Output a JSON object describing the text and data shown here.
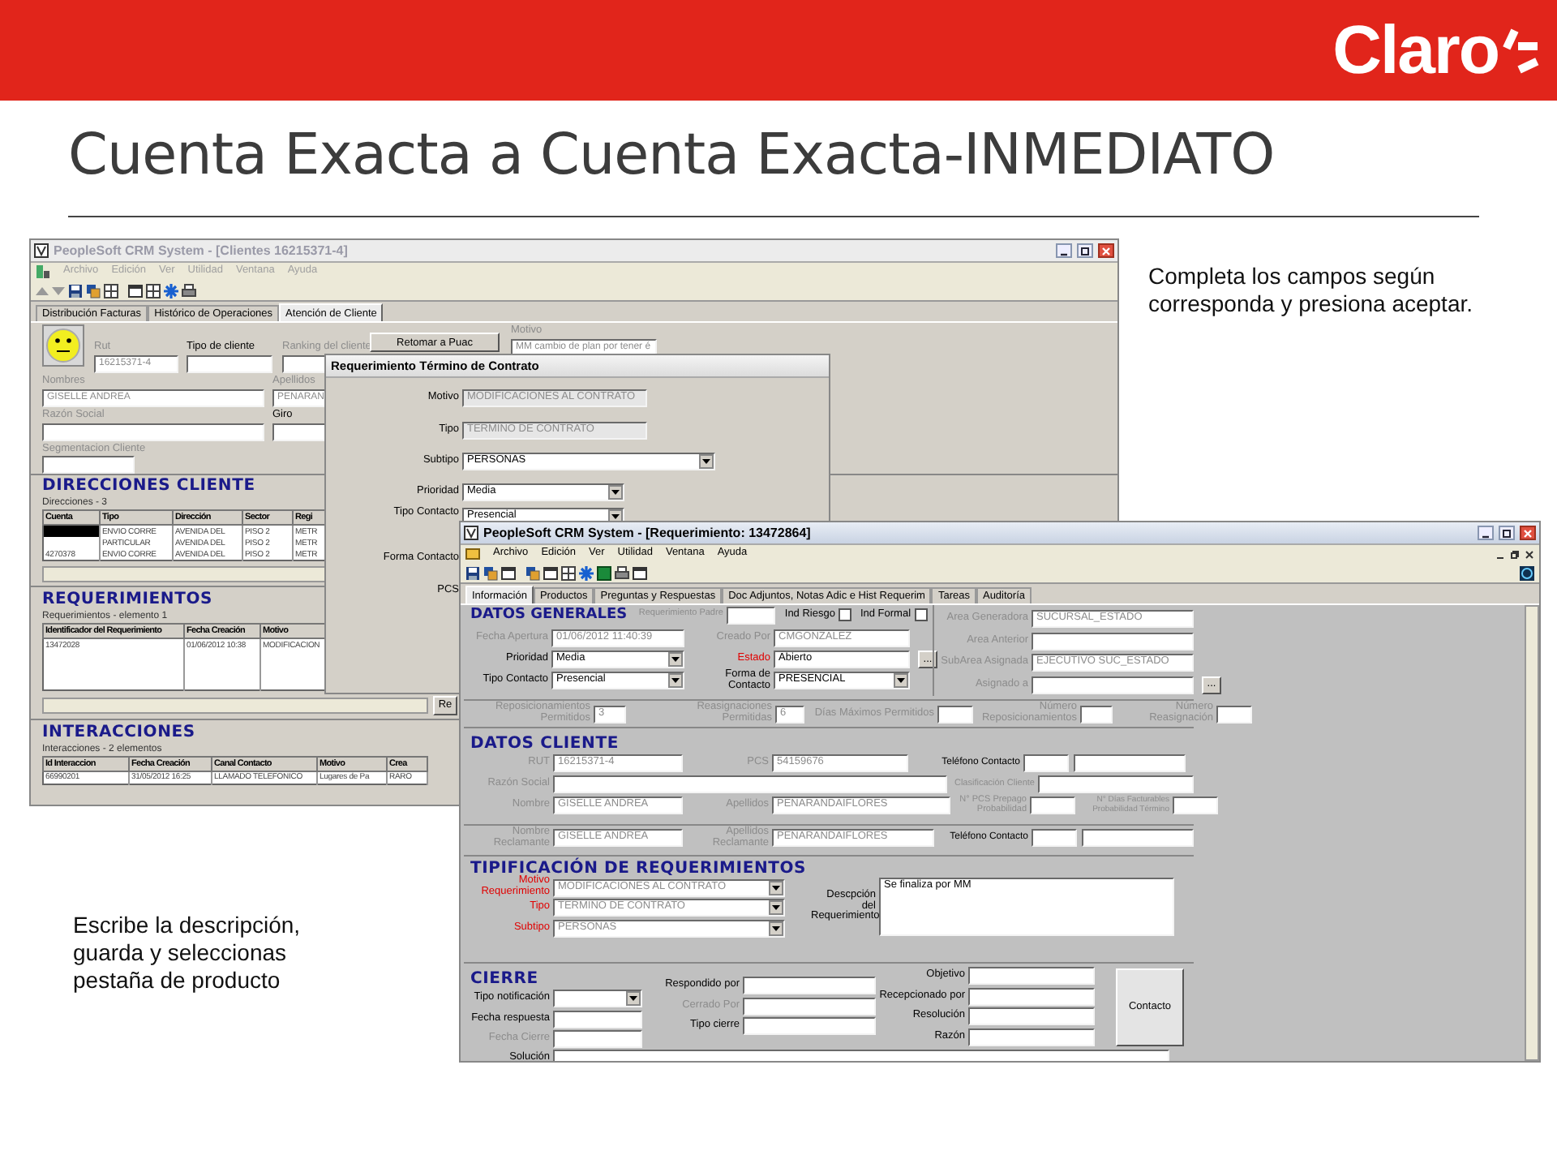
{
  "header": {
    "logo": "Claro"
  },
  "title": "Cuenta Exacta a Cuenta Exacta-INMEDIATO",
  "notes": [
    "Completa los campos según corresponda y presiona aceptar.",
    "Escribe la descripción, guarda y seleccionas pestaña de producto"
  ],
  "clientes_window": {
    "title": "PeopleSoft CRM System - [Clientes 16215371-4]",
    "active": false,
    "menu": [
      "Archivo",
      "Edición",
      "Ver",
      "Utilidad",
      "Ventana",
      "Ayuda"
    ],
    "tabs": [
      {
        "label": "Distribución Facturas",
        "selected": false
      },
      {
        "label": "Histórico de Operaciones",
        "selected": false
      },
      {
        "label": "Atención de Cliente",
        "selected": true
      }
    ],
    "fields": [
      {
        "label": "Rut",
        "value": "16215371-4",
        "kind": "text",
        "disabled": true
      },
      {
        "label": "Tipo de cliente",
        "kind": "text",
        "disabled": false
      },
      {
        "label": "Ranking del cliente",
        "kind": "text",
        "disabled": true
      },
      {
        "label": "Motivo",
        "value": "MM cambio de plan por tener é",
        "kind": "text",
        "disabled": true
      },
      {
        "label": "Nombres",
        "value": "GISELLE ANDREA",
        "kind": "text",
        "disabled": true
      },
      {
        "label": "Apellidos",
        "value": "PENARAN",
        "kind": "text",
        "disabled": true
      },
      {
        "label": "Razón Social",
        "kind": "text",
        "disabled": true
      },
      {
        "label": "Giro",
        "kind": "text",
        "disabled": false
      },
      {
        "label": "Segmentacion Cliente",
        "kind": "text",
        "disabled": true
      }
    ],
    "button": "Retomar a Puac",
    "side_button": "Re",
    "sections": [
      {
        "title": "DIRECCIONES CLIENTE",
        "count": "Direcciones - 3",
        "columns": [
          "Cuenta",
          "Tipo",
          "Dirección",
          "Sector",
          "Regi"
        ],
        "rows": [
          {
            "cells": [
              null,
              "ENVIO CORRE",
              "AVENIDA DEL",
              "PISO 2",
              "METR"
            ],
            "selected": true
          },
          {
            "cells": [
              null,
              "PARTICULAR",
              "AVENIDA DEL",
              "PISO 2",
              "METR"
            ],
            "selected": false
          },
          {
            "cells": [
              "4270378",
              "ENVIO CORRE",
              "AVENIDA DEL",
              "PISO 2",
              "METR"
            ],
            "selected": false
          }
        ]
      },
      {
        "title": "REQUERIMIENTOS",
        "count": "Requerimientos - elemento 1",
        "columns": [
          "Identificador del Requerimiento",
          "Fecha Creación",
          "Motivo"
        ],
        "rows": [
          {
            "cells": [
              "13472028",
              "01/06/2012 10:38",
              "MODIFICACION"
            ],
            "selected": false
          }
        ]
      },
      {
        "title": "INTERACCIONES",
        "count": "Interacciones - 2 elementos",
        "columns": [
          "Id Interaccion",
          "Fecha Creación",
          "Canal Contacto",
          "Motivo",
          "Crea"
        ],
        "rows": [
          {
            "cells": [
              "66990201",
              "31/05/2012 16:25",
              "LLAMADO TELEFONICO",
              "Lugares de Pa",
              "RARO"
            ],
            "selected": false
          }
        ]
      }
    ]
  },
  "dialog": {
    "title": "Requerimiento Término de Contrato",
    "fields": [
      {
        "label": "Motivo",
        "value": "MODIFICACIONES AL CONTRATO",
        "kind": "text",
        "disabled": true
      },
      {
        "label": "Tipo",
        "value": "TERMINO DE CONTRATO",
        "kind": "text",
        "disabled": true
      },
      {
        "label": "Subtipo",
        "value": "PERSONAS",
        "kind": "select",
        "disabled": false
      },
      {
        "label": "Prioridad",
        "value": "Media",
        "kind": "select",
        "disabled": false
      },
      {
        "label": "Tipo Contacto",
        "value": "Presencial",
        "kind": "select",
        "disabled": false
      },
      {
        "label": "Forma Contacto",
        "kind": "label"
      },
      {
        "label": "PCS",
        "kind": "label"
      }
    ]
  },
  "requerimiento_window": {
    "title": "PeopleSoft CRM System - [Requerimiento: 13472864]",
    "active": true,
    "menu": [
      "Archivo",
      "Edición",
      "Ver",
      "Utilidad",
      "Ventana",
      "Ayuda"
    ],
    "tabs": [
      {
        "label": "Información",
        "selected": true
      },
      {
        "label": "Productos",
        "selected": false
      },
      {
        "label": "Preguntas y Respuestas",
        "selected": false
      },
      {
        "label": "Doc Adjuntos, Notas Adic e Hist Requerim",
        "selected": false
      },
      {
        "label": "Tareas",
        "selected": false
      },
      {
        "label": "Auditoría",
        "selected": false
      }
    ],
    "datos_generales": {
      "title": "DATOS GENERALES",
      "fields": [
        {
          "label": "Requerimiento Padre",
          "kind": "text",
          "disabled": true
        },
        {
          "label": "Ind Riesgo",
          "kind": "check",
          "checked": false
        },
        {
          "label": "Ind Formal",
          "kind": "check",
          "checked": false
        },
        {
          "label": "Fecha Apertura",
          "value": "01/06/2012 11:40:39",
          "kind": "text",
          "disabled": true
        },
        {
          "label": "Creado Por",
          "value": "CMGONZALEZ",
          "kind": "text",
          "disabled": true
        },
        {
          "label": "Prioridad",
          "value": "Media",
          "kind": "select",
          "disabled": false
        },
        {
          "label": "Estado",
          "value": "Abierto",
          "kind": "text",
          "disabled": false,
          "required": true,
          "button": "..."
        },
        {
          "label": "Tipo Contacto",
          "value": "Presencial",
          "kind": "select",
          "disabled": false
        },
        {
          "label": "Forma de Contacto",
          "value": "PRESENCIAL",
          "kind": "select",
          "disabled": false
        }
      ],
      "area_fields": [
        {
          "label": "Area Generadora",
          "value": "SUCURSAL_ESTADO",
          "kind": "text",
          "disabled": true
        },
        {
          "label": "Area Anterior",
          "kind": "text",
          "disabled": true
        },
        {
          "label": "SubArea Asignada",
          "value": "EJECUTIVO SUC_ESTADO",
          "kind": "text",
          "disabled": true
        },
        {
          "label": "Asignado a",
          "kind": "text",
          "disabled": true,
          "button": "..."
        }
      ],
      "counters": [
        {
          "label": "Reposicionamientos Permitidos",
          "value": "3",
          "kind": "text",
          "disabled": true
        },
        {
          "label": "Reasignaciones Permitidas",
          "value": "6",
          "kind": "text",
          "disabled": true
        },
        {
          "label": "Días Máximos Permitidos",
          "kind": "text",
          "disabled": true
        },
        {
          "label": "Número Reposicionamientos",
          "kind": "text",
          "disabled": true
        },
        {
          "label": "Número Reasignación",
          "kind": "text",
          "disabled": true
        }
      ]
    },
    "datos_cliente": {
      "title": "DATOS CLIENTE",
      "fields": [
        {
          "label": "RUT",
          "value": "16215371-4",
          "kind": "text",
          "disabled": true
        },
        {
          "label": "PCS",
          "value": "54159676",
          "kind": "text",
          "disabled": true
        },
        {
          "label": "Teléfono Contacto",
          "kind": "phone",
          "disabled": false
        },
        {
          "label": "Razón Social",
          "kind": "text",
          "disabled": true
        },
        {
          "label": "Clasificación Cliente",
          "kind": "text",
          "disabled": true
        },
        {
          "label": "Nombre",
          "value": "GISELLE ANDREA",
          "kind": "text",
          "disabled": true
        },
        {
          "label": "Apellidos",
          "value": "PENARANDAIFLORES",
          "kind": "text",
          "disabled": true
        },
        {
          "label": "N° PCS Prepago Probabilidad",
          "kind": "text",
          "disabled": true
        },
        {
          "label": "N° Días Facturables Probabilidad Término",
          "kind": "text",
          "disabled": true
        },
        {
          "label": "Nombre Reclamante",
          "value": "GISELLE ANDREA",
          "kind": "text",
          "disabled": true
        },
        {
          "label": "Apellidos Reclamante",
          "value": "PENARANDAIFLORES",
          "kind": "text",
          "disabled": true
        },
        {
          "label": "Teléfono Contacto",
          "kind": "phone",
          "disabled": false
        }
      ]
    },
    "tipificacion": {
      "title": "TIPIFICACIÓN DE REQUERIMIENTOS",
      "fields": [
        {
          "label": "Motivo Requerimiento",
          "value": "MODIFICACIONES AL CONTRATO",
          "kind": "select",
          "disabled": true,
          "required": true
        },
        {
          "label": "Tipo",
          "value": "TERMINO DE CONTRATO",
          "kind": "select",
          "disabled": true,
          "required": true
        },
        {
          "label": "Subtipo",
          "value": "PERSONAS",
          "kind": "select",
          "disabled": true,
          "required": true
        },
        {
          "label": "Descpción del Requerimiento",
          "value": "Se finaliza por MM",
          "kind": "area",
          "disabled": false
        }
      ]
    },
    "cierre": {
      "title": "CIERRE",
      "button": "Contacto",
      "fields": [
        {
          "label": "Tipo notificación",
          "kind": "select",
          "disabled": false
        },
        {
          "label": "Fecha respuesta",
          "kind": "text",
          "disabled": false
        },
        {
          "label": "Fecha Cierre",
          "kind": "text",
          "disabled": true
        },
        {
          "label": "Respondido por",
          "kind": "text",
          "disabled": false
        },
        {
          "label": "Cerrado Por",
          "kind": "text",
          "disabled": true
        },
        {
          "label": "Tipo cierre",
          "kind": "text",
          "disabled": false
        },
        {
          "label": "Objetivo",
          "kind": "text",
          "disabled": false
        },
        {
          "label": "Recepcionado por",
          "kind": "text",
          "disabled": false
        },
        {
          "label": "Resolución",
          "kind": "text",
          "disabled": false
        },
        {
          "label": "Razón",
          "kind": "text",
          "disabled": false
        },
        {
          "label": "Solución",
          "kind": "text",
          "disabled": false
        }
      ]
    }
  }
}
